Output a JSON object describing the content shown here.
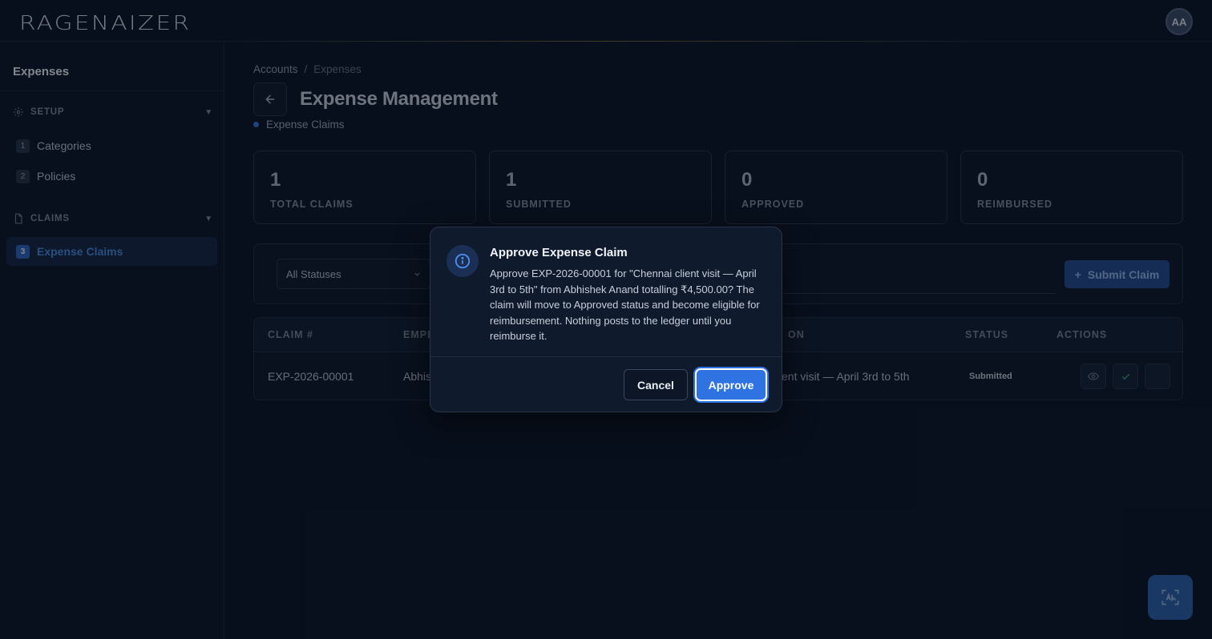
{
  "header": {
    "logo_text": "RAGENAIZER",
    "avatar_initials": "AA"
  },
  "sidebar": {
    "title": "Expenses",
    "sections": [
      {
        "label": "SETUP",
        "icon": "gear-icon",
        "items": [
          {
            "number": "1",
            "label": "Categories"
          },
          {
            "number": "2",
            "label": "Policies"
          }
        ]
      },
      {
        "label": "CLAIMS",
        "icon": "document-icon",
        "items": [
          {
            "number": "3",
            "label": "Expense Claims",
            "active": true
          }
        ]
      }
    ]
  },
  "breadcrumb": {
    "items": [
      "Accounts",
      "Expenses"
    ],
    "separator": "/"
  },
  "page": {
    "title": "Expense Management",
    "subtitle": "Expense Claims"
  },
  "stats": [
    {
      "value": "1",
      "label": "TOTAL CLAIMS"
    },
    {
      "value": "1",
      "label": "SUBMITTED"
    },
    {
      "value": "0",
      "label": "APPROVED"
    },
    {
      "value": "0",
      "label": "REIMBURSED"
    }
  ],
  "filters": {
    "status_selected": "All Statuses",
    "submit_label": "Submit Claim"
  },
  "table": {
    "columns": [
      "CLAIM #",
      "EMPL",
      "ON",
      "STATUS",
      "ACTIONS"
    ],
    "rows": [
      {
        "claim_no": "EXP-2026-00001",
        "employee": "Abhis",
        "description": "ent visit — April 3rd to 5th",
        "status": "Submitted"
      }
    ]
  },
  "modal": {
    "title": "Approve Expense Claim",
    "body": "Approve EXP-2026-00001 for \"Chennai client visit — April 3rd to 5th\" from Abhishek Anand totalling ₹4,500.00? The claim will move to Approved status and become eligible for reimbursement. Nothing posts to the ledger until you reimburse it.",
    "cancel_label": "Cancel",
    "approve_label": "Approve"
  },
  "colors": {
    "background": "#0b1324",
    "accent": "#2f73e3",
    "active_nav": "#4a86d8"
  }
}
